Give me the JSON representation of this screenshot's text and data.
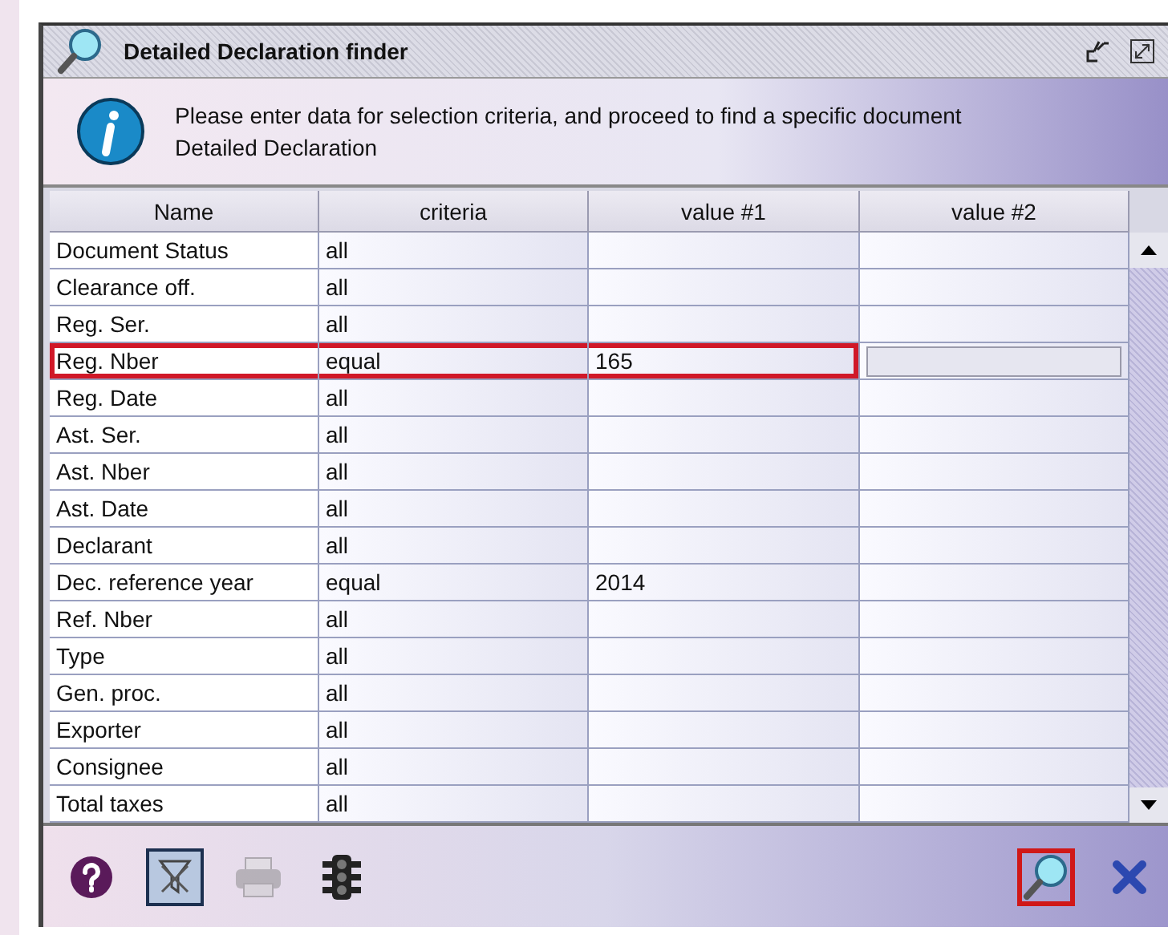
{
  "window": {
    "title": "Detailed Declaration finder"
  },
  "info": {
    "message": "Please enter data for selection criteria, and proceed to find a specific document Detailed Declaration"
  },
  "table": {
    "columns": [
      "Name",
      "criteria",
      "value #1",
      "value #2"
    ],
    "rows": [
      {
        "name": "Document Status",
        "criteria": "all",
        "value_1": "",
        "highlighted": false,
        "editing": false
      },
      {
        "name": "Clearance off.",
        "criteria": "all",
        "value_1": "",
        "highlighted": false,
        "editing": false
      },
      {
        "name": "Reg. Ser.",
        "criteria": "all",
        "value_1": "",
        "highlighted": false,
        "editing": false
      },
      {
        "name": "Reg. Nber",
        "criteria": "equal",
        "value_1": "165",
        "highlighted": true,
        "editing": true
      },
      {
        "name": "Reg. Date",
        "criteria": "all",
        "value_1": "",
        "highlighted": false,
        "editing": false
      },
      {
        "name": "Ast. Ser.",
        "criteria": "all",
        "value_1": "",
        "highlighted": false,
        "editing": false
      },
      {
        "name": "Ast. Nber",
        "criteria": "all",
        "value_1": "",
        "highlighted": false,
        "editing": false
      },
      {
        "name": "Ast. Date",
        "criteria": "all",
        "value_1": "",
        "highlighted": false,
        "editing": false
      },
      {
        "name": "Declarant",
        "criteria": "all",
        "value_1": "",
        "highlighted": false,
        "editing": false
      },
      {
        "name": "Dec. reference year",
        "criteria": "equal",
        "value_1": "2014",
        "highlighted": false,
        "editing": false
      },
      {
        "name": "Ref. Nber",
        "criteria": "all",
        "value_1": "",
        "highlighted": false,
        "editing": false
      },
      {
        "name": "Type",
        "criteria": "all",
        "value_1": "",
        "highlighted": false,
        "editing": false
      },
      {
        "name": "Gen. proc.",
        "criteria": "all",
        "value_1": "",
        "highlighted": false,
        "editing": false
      },
      {
        "name": "Exporter",
        "criteria": "all",
        "value_1": "",
        "highlighted": false,
        "editing": false
      },
      {
        "name": "Consignee",
        "criteria": "all",
        "value_1": "",
        "highlighted": false,
        "editing": false
      },
      {
        "name": "Total taxes",
        "criteria": "all",
        "value_1": "",
        "highlighted": false,
        "editing": false
      }
    ]
  },
  "toolbar": {
    "left": [
      {
        "kind": "help",
        "pressed": false,
        "disabled": false
      },
      {
        "kind": "filter",
        "pressed": true,
        "disabled": false
      },
      {
        "kind": "print",
        "pressed": false,
        "disabled": true
      },
      {
        "kind": "traffic",
        "pressed": false,
        "disabled": false
      }
    ],
    "right": [
      {
        "kind": "find",
        "highlighted": true
      },
      {
        "kind": "close",
        "highlighted": false
      }
    ]
  }
}
